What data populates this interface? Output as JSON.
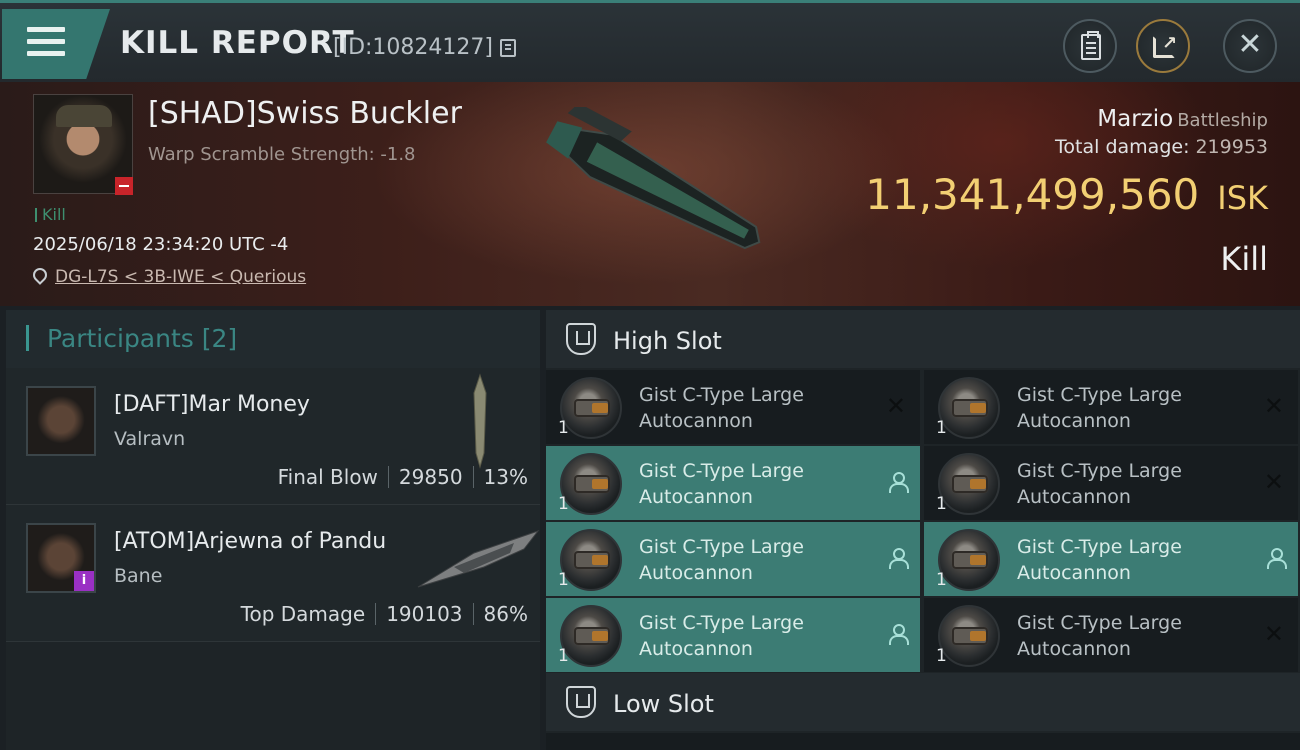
{
  "header": {
    "title": "KILL REPORT",
    "report_id": "[ID:10824127]"
  },
  "victim": {
    "name": "[SHAD]Swiss Buckler",
    "subtitle": "Warp Scramble Strength: -1.8",
    "kill_tag": "Kill",
    "timestamp": "2025/06/18 23:34:20 UTC -4",
    "location": "DG-L7S < 3B-IWE < Querious",
    "ship_name": "Marzio",
    "ship_class": "Battleship",
    "total_damage_label": "Total damage:",
    "total_damage": "219953",
    "isk_value": "11,341,499,560",
    "isk_unit": "ISK",
    "result": "Kill"
  },
  "participants": {
    "label": "Participants",
    "count": "[2]",
    "rows": [
      {
        "name": "[DAFT]Mar Money",
        "ship": "Valravn",
        "role": "Final Blow",
        "damage": "29850",
        "percent": "13%"
      },
      {
        "name": "[ATOM]Arjewna of Pandu",
        "ship": "Bane",
        "role": "Top Damage",
        "damage": "190103",
        "percent": "86%",
        "badge": "i"
      }
    ]
  },
  "slots": {
    "high_label": "High Slot",
    "low_label": "Low Slot",
    "modules": [
      {
        "name": "Gist C-Type Large Autocannon",
        "qty": "1",
        "fitted": false,
        "state": "destroyed"
      },
      {
        "name": "Gist C-Type Large Autocannon",
        "qty": "1",
        "fitted": false,
        "state": "destroyed"
      },
      {
        "name": "Gist C-Type Large Autocannon",
        "qty": "1",
        "fitted": true,
        "state": "dropped"
      },
      {
        "name": "Gist C-Type Large Autocannon",
        "qty": "1",
        "fitted": false,
        "state": "destroyed"
      },
      {
        "name": "Gist C-Type Large Autocannon",
        "qty": "1",
        "fitted": true,
        "state": "dropped"
      },
      {
        "name": "Gist C-Type Large Autocannon",
        "qty": "1",
        "fitted": true,
        "state": "dropped"
      },
      {
        "name": "Gist C-Type Large Autocannon",
        "qty": "1",
        "fitted": true,
        "state": "dropped"
      },
      {
        "name": "Gist C-Type Large Autocannon",
        "qty": "1",
        "fitted": false,
        "state": "destroyed"
      }
    ]
  },
  "colors": {
    "accent": "#3a9690",
    "isk": "#f2cf73",
    "fitted_bg": "#3c7c74",
    "destroyed_badge": "#c8242a"
  }
}
